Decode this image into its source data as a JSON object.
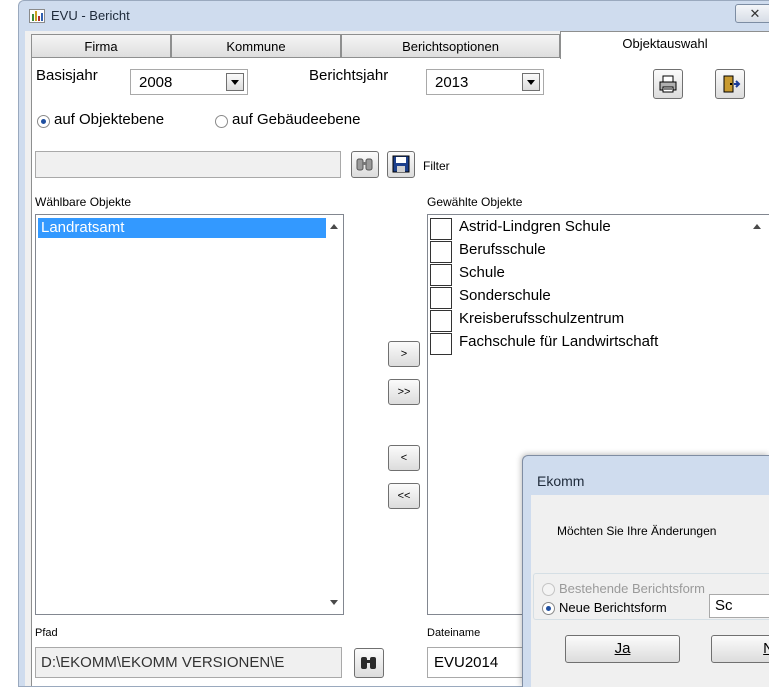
{
  "window": {
    "title": "EVU - Bericht",
    "close_label": "✕"
  },
  "tabs": [
    {
      "label": "Firma"
    },
    {
      "label": "Kommune"
    },
    {
      "label": "Berichtsoptionen"
    },
    {
      "label": "Objektauswahl"
    }
  ],
  "form": {
    "basisjahr_label": "Basisjahr",
    "basisjahr_value": "2008",
    "berichtsjahr_label": "Berichtsjahr",
    "berichtsjahr_value": "2013",
    "radio_objekt": "auf Objektebene",
    "radio_gebaeude": "auf Gebäudeebene",
    "filter_label": "Filter",
    "waehlbare_label": "Wählbare Objekte",
    "gewaehlte_label": "Gewählte Objekte",
    "pfad_label": "Pfad",
    "pfad_value": "D:\\EKOMM\\EKOMM VERSIONEN\\E",
    "dateiname_label": "Dateiname",
    "dateiname_value": "EVU2014"
  },
  "waehlbare_objekte": [
    "Landratsamt"
  ],
  "gewaehlte_objekte": [
    "Astrid-Lindgren Schule",
    "Berufsschule",
    "Schule",
    "Sonderschule",
    "Kreisberufsschulzentrum",
    "Fachschule für Landwirtschaft"
  ],
  "move_buttons": {
    "add": ">",
    "add_all": ">>",
    "remove": "<",
    "remove_all": "<<"
  },
  "dialog": {
    "title": "Ekomm",
    "question": "Möchten Sie Ihre Änderungen",
    "option_existing": "Bestehende Berichtsform",
    "option_new": "Neue Berichtsform",
    "new_name_value": "Sc",
    "yes_label": "Ja",
    "no_label": "N"
  },
  "icons": {
    "app": "chart-icon",
    "print": "printer-icon",
    "exit": "exit-door-icon",
    "search": "binoculars-icon",
    "save": "floppy-disk-icon"
  },
  "colors": {
    "selection": "#3399ff",
    "window_frame": "#cfdcee"
  }
}
